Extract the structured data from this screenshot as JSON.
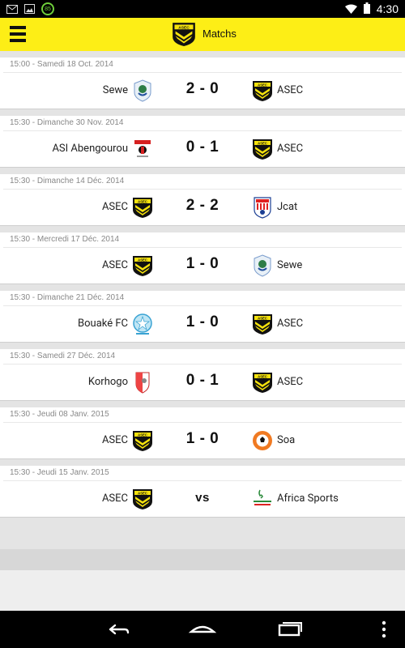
{
  "status_bar": {
    "time": "4:30",
    "battery_badge": "85",
    "icons": [
      "mail-icon",
      "image-icon",
      "battery-badge",
      "wifi-icon",
      "battery-icon"
    ]
  },
  "app_bar": {
    "title": "Matchs",
    "menu_icon": "hamburger-menu-icon",
    "accent_color": "#fdee16"
  },
  "matches": [
    {
      "date": "15:00 - Samedi 18 Oct. 2014",
      "home": "Sewe",
      "home_logo": "sewe",
      "score": "2 - 0",
      "away": "ASEC",
      "away_logo": "asec"
    },
    {
      "date": "15:30 - Dimanche 30 Nov. 2014",
      "home": "ASI Abengourou",
      "home_logo": "asi",
      "score": "0 - 1",
      "away": "ASEC",
      "away_logo": "asec"
    },
    {
      "date": "15:30 - Dimanche 14 Déc. 2014",
      "home": "ASEC",
      "home_logo": "asec",
      "score": "2 - 2",
      "away": "Jcat",
      "away_logo": "jcat"
    },
    {
      "date": "15:30 - Mercredi 17 Déc. 2014",
      "home": "ASEC",
      "home_logo": "asec",
      "score": "1 - 0",
      "away": "Sewe",
      "away_logo": "sewe"
    },
    {
      "date": "15:30 - Dimanche 21 Déc. 2014",
      "home": "Bouaké FC",
      "home_logo": "bouake",
      "score": "1 - 0",
      "away": "ASEC",
      "away_logo": "asec"
    },
    {
      "date": "15:30 - Samedi 27 Déc. 2014",
      "home": "Korhogo",
      "home_logo": "korhogo",
      "score": "0 - 1",
      "away": "ASEC",
      "away_logo": "asec"
    },
    {
      "date": "15:30 - Jeudi 08 Janv. 2015",
      "home": "ASEC",
      "home_logo": "asec",
      "score": "1 - 0",
      "away": "Soa",
      "away_logo": "soa"
    },
    {
      "date": "15:30 - Jeudi 15 Janv. 2015",
      "home": "ASEC",
      "home_logo": "asec",
      "score": "vs",
      "away": "Africa Sports",
      "away_logo": "africa"
    }
  ],
  "nav_bar": {
    "buttons": [
      "back-icon",
      "home-icon",
      "recent-apps-icon",
      "overflow-menu-icon"
    ]
  }
}
